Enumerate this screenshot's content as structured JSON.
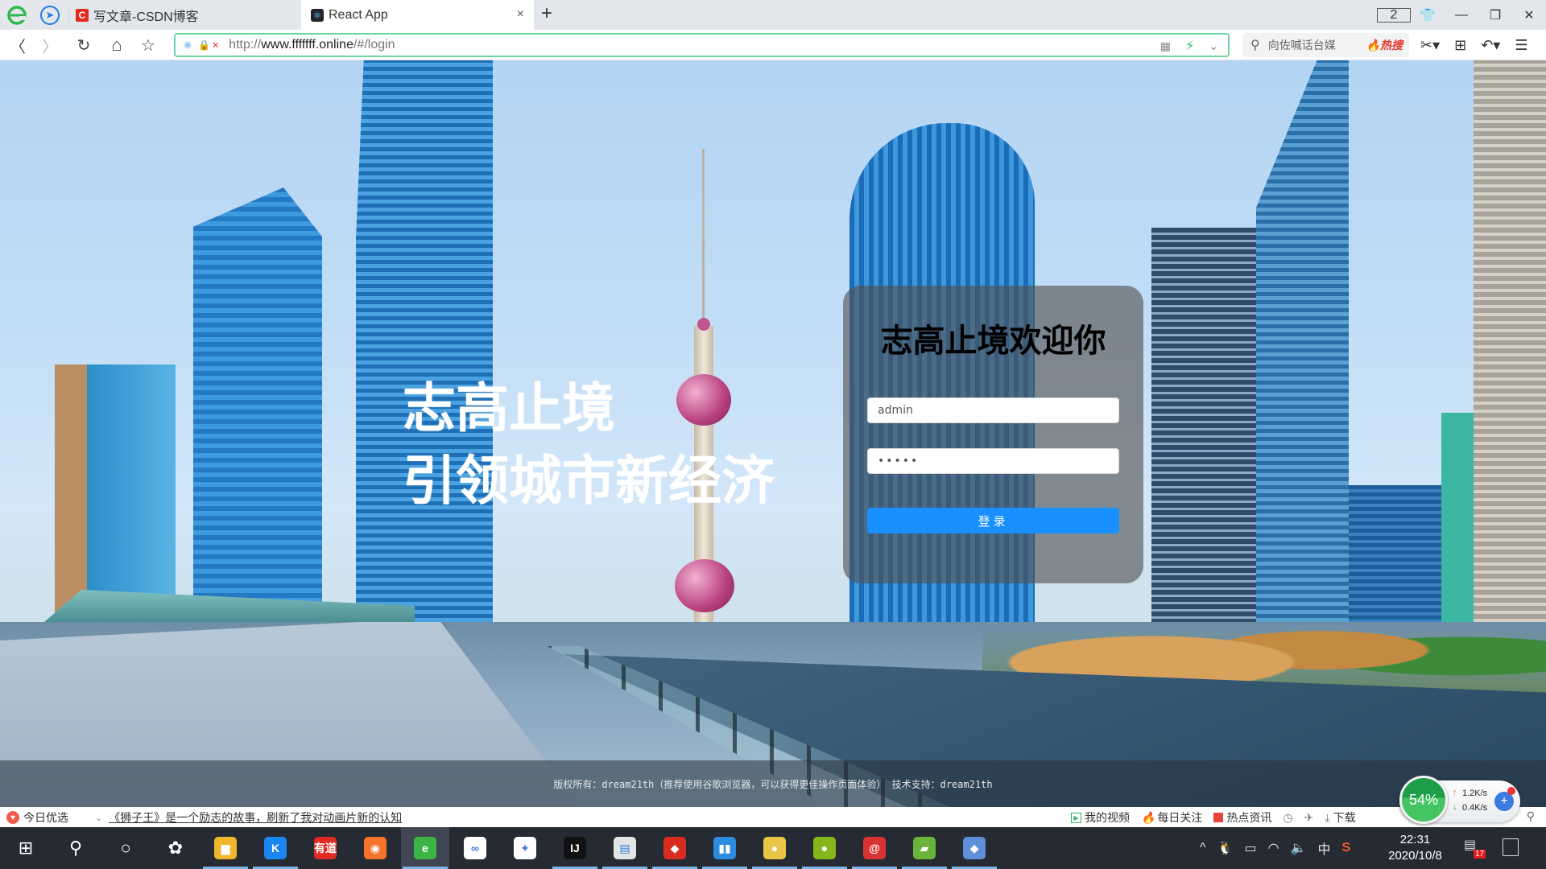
{
  "browser": {
    "tabs": [
      {
        "label": "写文章-CSDN博客",
        "icon": "csdn-icon",
        "icon_text": "C",
        "active": false
      },
      {
        "label": "React App",
        "icon": "react-icon",
        "active": true
      }
    ],
    "new_tab_symbol": "+",
    "close_symbol": "×",
    "window_count": "2",
    "window_controls": {
      "skin": "👕",
      "minimize": "—",
      "maximize": "❐",
      "close": "✕"
    },
    "address": {
      "url_prefix": "http://",
      "url_host": "www.fffffff.online",
      "url_path": "/#/login"
    },
    "search": {
      "placeholder": "向佐喊话台媒",
      "hot_label": "热搜"
    },
    "nav": {
      "back": "〈",
      "forward": "〉",
      "reload": "↻",
      "home": "⌂",
      "bookmark": "☆"
    }
  },
  "page": {
    "hero": {
      "line1": "志高止境",
      "line2": "引领城市新经济"
    },
    "login": {
      "title": "志高止境欢迎你",
      "username_value": "admin",
      "password_value": "•••••",
      "submit_label": "登录"
    },
    "footer": "版权所有：dream21th（推荐使用谷歌浏览器，可以获得更佳操作页面体验） 技术支持：dream21th",
    "colors": {
      "primary": "#1890ff",
      "accent_green": "#6dd6a3"
    }
  },
  "statusbar": {
    "today_label": "今日优选",
    "news_link": "《狮子王》是一个励志的故事，刷新了我对动画片新的认知",
    "right_items": [
      {
        "label": "我的视频",
        "icon": "video-icon"
      },
      {
        "label": "每日关注",
        "icon": "fire-icon"
      },
      {
        "label": "热点资讯",
        "icon": "news-icon"
      },
      {
        "label": "",
        "icon": "clock-icon",
        "symbol": "◷"
      },
      {
        "label": "",
        "icon": "rocket-icon",
        "symbol": "✈"
      },
      {
        "label": "下载",
        "icon": "download-icon",
        "symbol": "⤓"
      }
    ],
    "speed": {
      "percent": "54%",
      "upload": "1.2K/s",
      "download": "0.4K/s"
    }
  },
  "taskbar": {
    "apps": [
      {
        "name": "start",
        "symbol": "⊞",
        "bg": "transparent"
      },
      {
        "name": "search",
        "symbol": "⚲",
        "bg": "transparent"
      },
      {
        "name": "cortana",
        "symbol": "○",
        "bg": "transparent"
      },
      {
        "name": "pinwheel",
        "symbol": "✿",
        "bg": "transparent"
      },
      {
        "name": "file-explorer",
        "symbol": "▆",
        "bg": "#f1b72c"
      },
      {
        "name": "kugou",
        "symbol": "K",
        "bg": "#1b86f2"
      },
      {
        "name": "youdao",
        "symbol": "有道",
        "bg": "#e02b22"
      },
      {
        "name": "firefox",
        "symbol": "◉",
        "bg": "#f5742a"
      },
      {
        "name": "browser-360",
        "symbol": "e",
        "bg": "#3cb545"
      },
      {
        "name": "baidu-netdisk",
        "symbol": "∞",
        "bg": "#ffffff"
      },
      {
        "name": "feishu",
        "symbol": "✦",
        "bg": "#ffffff"
      },
      {
        "name": "intellij",
        "symbol": "IJ",
        "bg": "#111111"
      },
      {
        "name": "terminal",
        "symbol": "▤",
        "bg": "#dfe6e3"
      },
      {
        "name": "redis",
        "symbol": "◆",
        "bg": "#d82c20"
      },
      {
        "name": "media-tool",
        "symbol": "▮▮",
        "bg": "#2c8de0"
      },
      {
        "name": "app-yellow",
        "symbol": "●",
        "bg": "#e8c547"
      },
      {
        "name": "app-melon",
        "symbol": "●",
        "bg": "#86b51e"
      },
      {
        "name": "app-snail",
        "symbol": "@",
        "bg": "#d93232"
      },
      {
        "name": "app-green",
        "symbol": "▰",
        "bg": "#6bb33a"
      },
      {
        "name": "app-diamond",
        "symbol": "◆",
        "bg": "#5f8fd8"
      }
    ],
    "tray": {
      "chevron": "^",
      "ime": "中",
      "time": "22:31",
      "date": "2020/10/8",
      "notification_count": "17"
    }
  }
}
